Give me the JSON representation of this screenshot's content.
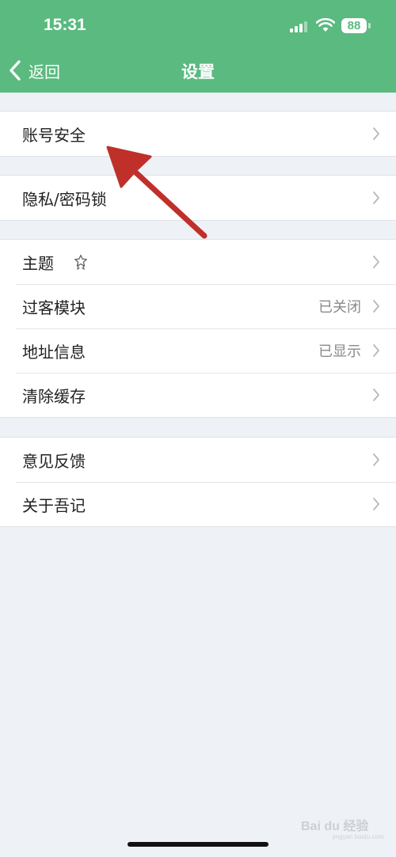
{
  "status_bar": {
    "time": "15:31",
    "battery": "88"
  },
  "nav": {
    "back_label": "返回",
    "title": "设置"
  },
  "groups": [
    {
      "items": [
        {
          "label": "账号安全",
          "value": ""
        }
      ]
    },
    {
      "items": [
        {
          "label": "隐私/密码锁",
          "value": ""
        }
      ]
    },
    {
      "items": [
        {
          "label": "主题",
          "value": "",
          "icon": "star-ribbon-icon"
        },
        {
          "label": "过客模块",
          "value": "已关闭"
        },
        {
          "label": "地址信息",
          "value": "已显示"
        },
        {
          "label": "清除缓存",
          "value": ""
        }
      ]
    },
    {
      "items": [
        {
          "label": "意见反馈",
          "value": ""
        },
        {
          "label": "关于吾记",
          "value": ""
        }
      ]
    }
  ],
  "watermark": {
    "text": "Bai du 经验",
    "url": "jingyan.baidu.com"
  },
  "colors": {
    "header": "#5aba7f",
    "background": "#eef1f5",
    "annotation_arrow": "#c0302a"
  }
}
